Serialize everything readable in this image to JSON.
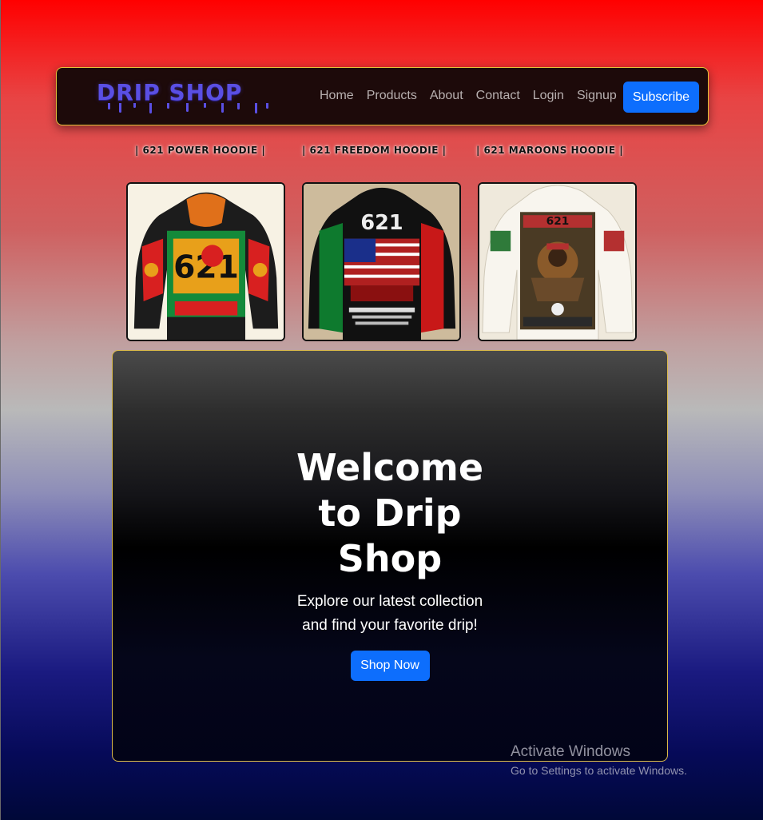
{
  "brand": {
    "name": "DRIP SHOP",
    "color": "#5a4fe3"
  },
  "nav": {
    "links": [
      "Home",
      "Products",
      "About",
      "Contact",
      "Login",
      "Signup"
    ],
    "subscribe_label": "Subscribe"
  },
  "products": [
    {
      "title": "| 621 POWER HOODIE |",
      "image_icon": "power-hoodie-image"
    },
    {
      "title": "| 621 FREEDOM HOODIE |",
      "image_icon": "freedom-hoodie-image"
    },
    {
      "title": "| 621 MAROONS HOODIE |",
      "image_icon": "maroons-hoodie-image"
    }
  ],
  "hero": {
    "title": "Welcome to Drip Shop",
    "subtitle": "Explore our latest collection and find your favorite drip!",
    "cta_label": "Shop Now"
  },
  "watermark": {
    "title": "Activate Windows",
    "subtitle": "Go to Settings to activate Windows."
  },
  "colors": {
    "accent": "#0d6efd",
    "border_gold": "#e3c23a",
    "navbar_bg": "#1d0a0a"
  }
}
